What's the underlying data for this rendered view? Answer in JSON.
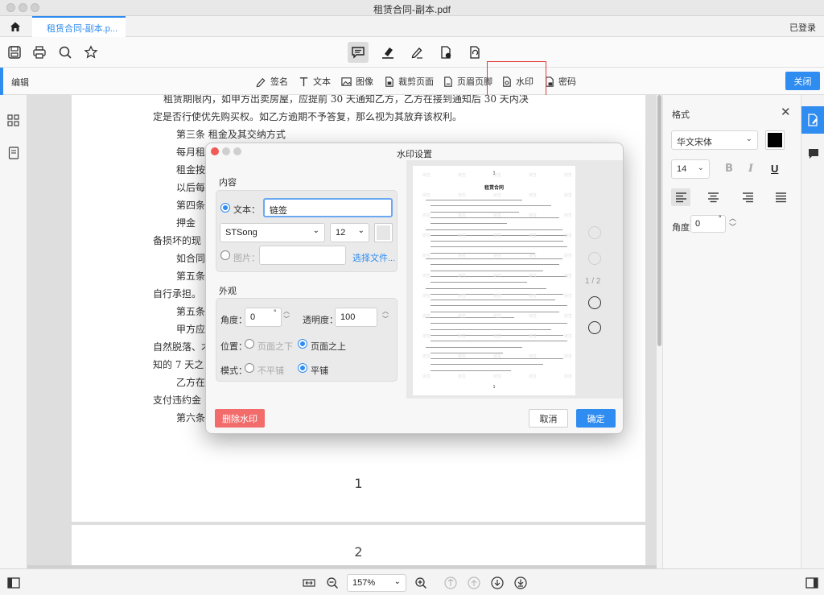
{
  "window": {
    "title": "租赁合同-副本.pdf"
  },
  "tabbar": {
    "tab_label": "租赁合同-副本.p...",
    "login": "已登录"
  },
  "toolbar": {
    "icons": [
      "save-icon",
      "print-icon",
      "search-icon",
      "star-icon",
      "comment-icon",
      "highlight-icon",
      "sign-icon",
      "page-stamp-icon",
      "page-rotate-icon"
    ]
  },
  "editbar": {
    "label": "编辑",
    "items": [
      {
        "label": "签名",
        "icon": "signature-icon"
      },
      {
        "label": "文本",
        "icon": "text-icon"
      },
      {
        "label": "图像",
        "icon": "image-icon"
      },
      {
        "label": "裁剪页面",
        "icon": "crop-icon"
      },
      {
        "label": "页眉页脚",
        "icon": "header-footer-icon"
      },
      {
        "label": "水印",
        "icon": "watermark-icon"
      },
      {
        "label": "密码",
        "icon": "password-icon"
      }
    ],
    "close": "关闭"
  },
  "document": {
    "lines": [
      "租赁期限内，如甲方出卖房屋，应提前 30 天通知乙方，乙方在接到通知后 30 天内决",
      "定是否行使优先购买权。如乙方逾期不予答复，那么视为其放弃该权利。",
      "第三条  租金及其交纳方式",
      "每月租",
      "租金按",
      "以后每",
      "第四条",
      "押金",
      "备损坏的现",
      "如合同",
      "第五条",
      "自行承担。",
      "第五条",
      "甲方应",
      "自然脱落、才",
      "知的 7 天之",
      "乙方在",
      "支付违约金",
      "第六条"
    ],
    "page1_number": "1",
    "page2_number": "2"
  },
  "format_panel": {
    "title": "格式",
    "font": "华文宋体",
    "size": "14",
    "bold": "B",
    "italic": "I",
    "underline": "U",
    "angle_label": "角度",
    "angle_value": "0",
    "degree": "°",
    "color": "#000000"
  },
  "statusbar": {
    "zoom": "157%"
  },
  "dialog": {
    "title": "水印设置",
    "content_section": "内容",
    "text_label": "文本：",
    "text_value": "链签",
    "font": "STSong",
    "font_size": "12",
    "image_label": "图片：",
    "choose_file": "选择文件...",
    "appearance_section": "外观",
    "angle_label": "角度：",
    "angle_value": "0",
    "degree": "°",
    "opacity_label": "透明度：",
    "opacity_value": "100",
    "position_label": "位置：",
    "position_below": "页面之下",
    "position_above": "页面之上",
    "mode_label": "模式：",
    "mode_nontile": "不平铺",
    "mode_tile": "平铺",
    "preview": {
      "page_num": "1",
      "doc_title": "租赁合同",
      "watermark": "链签",
      "page_indicator": "1 / 2",
      "footer_num": "1"
    },
    "delete_button": "删除水印",
    "cancel_button": "取消",
    "ok_button": "确定"
  }
}
